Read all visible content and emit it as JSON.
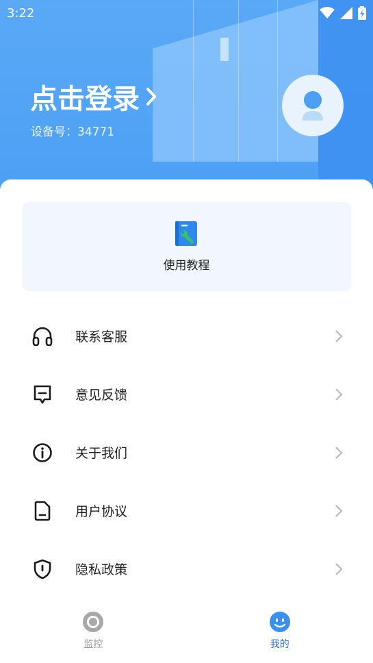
{
  "status_bar": {
    "time": "3:22"
  },
  "header": {
    "login_text": "点击登录",
    "device_label": "设备号：34771"
  },
  "tutorial": {
    "label": "使用教程"
  },
  "menu": {
    "items": [
      {
        "label": "联系客服",
        "icon": "headphones-icon"
      },
      {
        "label": "意见反馈",
        "icon": "feedback-icon"
      },
      {
        "label": "关于我们",
        "icon": "info-icon"
      },
      {
        "label": "用户协议",
        "icon": "document-icon"
      },
      {
        "label": "隐私政策",
        "icon": "shield-icon"
      }
    ]
  },
  "tabbar": {
    "tabs": [
      {
        "label": "监控",
        "active": false
      },
      {
        "label": "我的",
        "active": true
      }
    ]
  },
  "colors": {
    "primary": "#4b9ff4",
    "tab_inactive": "#9a9a9a",
    "text": "#222222"
  }
}
